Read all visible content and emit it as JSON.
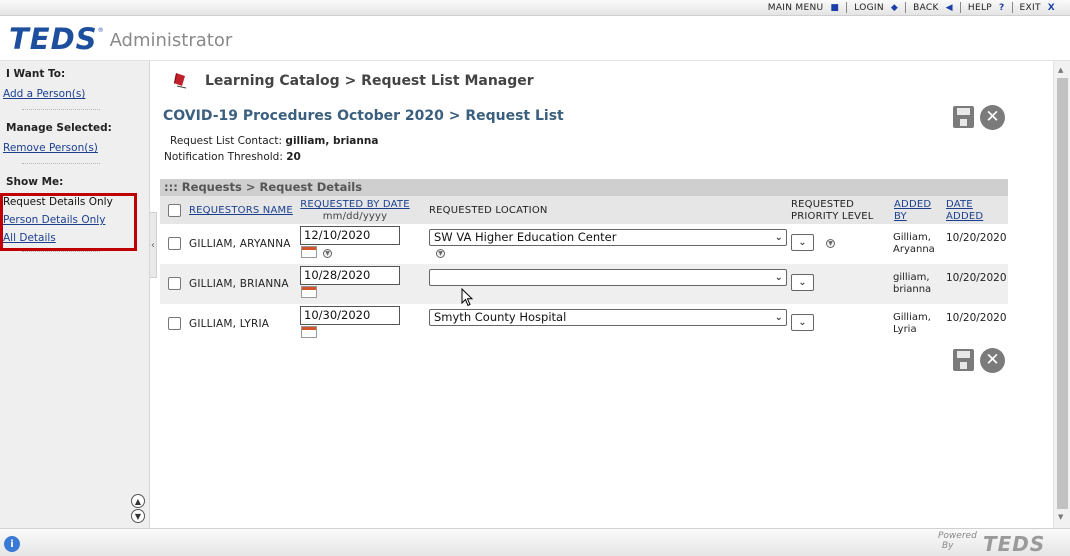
{
  "topnav": {
    "main_menu": "MAIN MENU",
    "login": "LOGIN",
    "back": "BACK",
    "help": "HELP",
    "help_glyph": "?",
    "exit": "EXIT",
    "exit_glyph": "X"
  },
  "header": {
    "logo_text": "TEDS",
    "logo_reg": "®",
    "app_name": "Administrator"
  },
  "sidebar": {
    "i_want_to": "I Want To:",
    "add_person": "Add a Person(s)",
    "manage_selected": "Manage Selected:",
    "remove_person": "Remove Person(s)",
    "show_me": "Show Me:",
    "request_details_only": "Request Details Only",
    "person_details_only": "Person Details Only",
    "all_details": "All Details",
    "highlight_color": "#c00000"
  },
  "main": {
    "breadcrumb": "Learning Catalog > Request List Manager",
    "request_list_title": "COVID-19 Procedures October 2020 > Request List",
    "contact_label": "Request List Contact:",
    "contact_value": "gilliam, brianna",
    "threshold_label": "Notification Threshold:",
    "threshold_value": "20",
    "section_title": "::: Requests > Request Details",
    "columns": {
      "requestors_name": "REQUESTORS NAME",
      "requested_by_date": "REQUESTED BY DATE",
      "date_format": "mm/dd/yyyy",
      "requested_location": "REQUESTED LOCATION",
      "priority_line1": "REQUESTED",
      "priority_line2": "PRIORITY LEVEL",
      "added_by_line1": "ADDED",
      "added_by_line2": "BY",
      "date_added_line1": "DATE",
      "date_added_line2": "ADDED"
    },
    "rows": [
      {
        "name": "GILLIAM, ARYANNA",
        "requested_date": "12/10/2020",
        "location": "SW VA Higher Education Center",
        "added_by_line1": "Gilliam,",
        "added_by_line2": "Aryanna",
        "date_added": "10/20/2020"
      },
      {
        "name": "GILLIAM, BRIANNA",
        "requested_date": "10/28/2020",
        "location": "",
        "added_by_line1": "gilliam,",
        "added_by_line2": "brianna",
        "date_added": "10/20/2020"
      },
      {
        "name": "GILLIAM, LYRIA",
        "requested_date": "10/30/2020",
        "location": "Smyth County Hospital",
        "added_by_line1": "Gilliam,",
        "added_by_line2": "Lyria",
        "date_added": "10/20/2020"
      }
    ]
  },
  "footer": {
    "powered_line1": "Powered",
    "powered_line2": "By",
    "powered_logo": "TEDS"
  }
}
